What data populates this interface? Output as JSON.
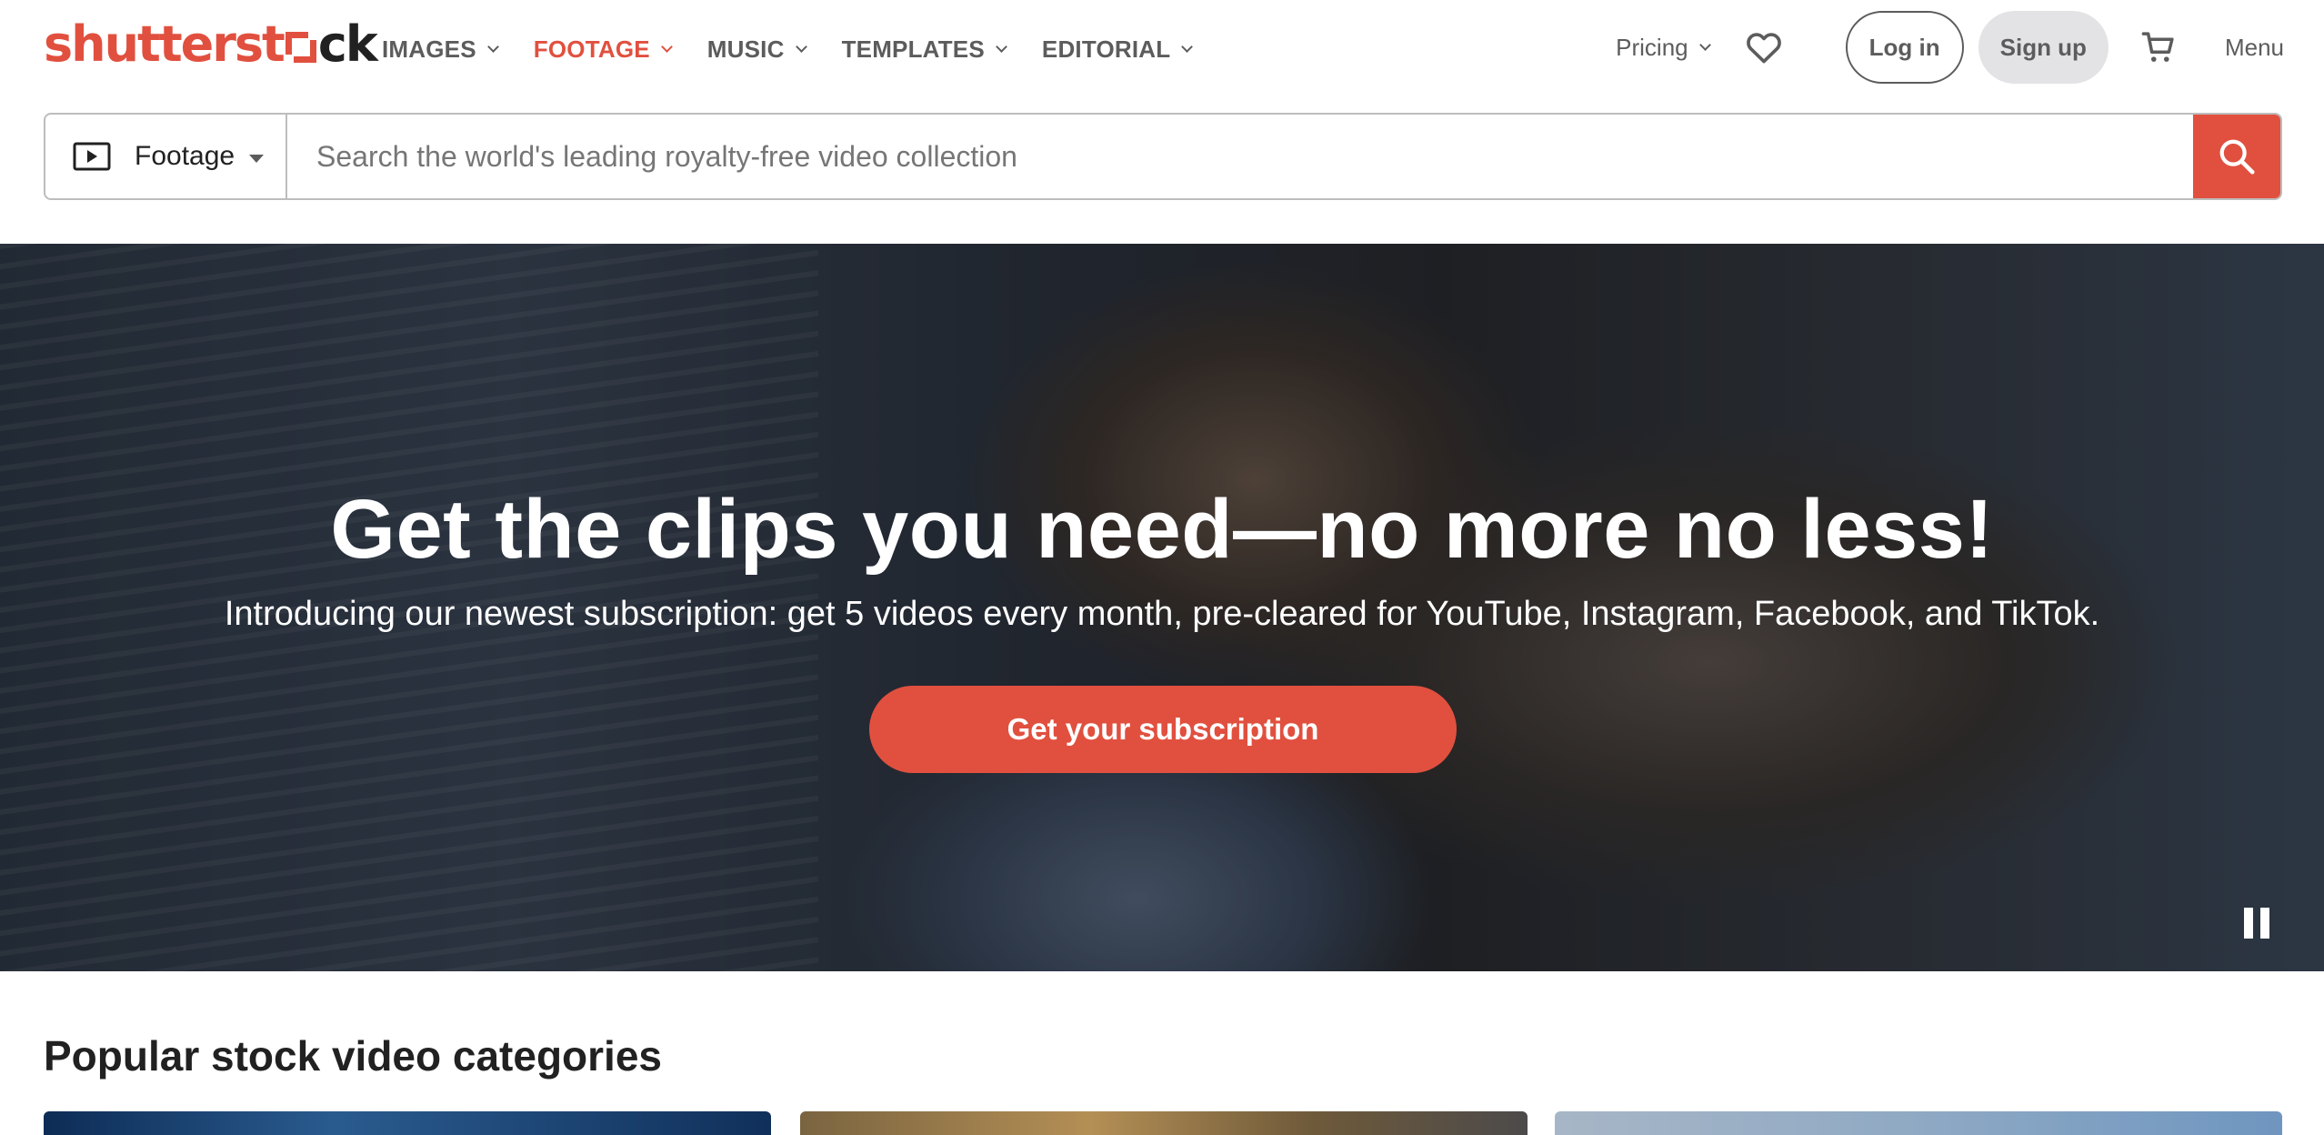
{
  "brand": {
    "logo_text_before": "shutterst",
    "logo_text_after": "ck",
    "colors": {
      "accent": "#e1503f",
      "text": "#212121",
      "muted": "#5c5c5c"
    }
  },
  "nav": {
    "items": [
      {
        "label": "IMAGES",
        "active": false
      },
      {
        "label": "FOOTAGE",
        "active": true
      },
      {
        "label": "MUSIC",
        "active": false
      },
      {
        "label": "TEMPLATES",
        "active": false
      },
      {
        "label": "EDITORIAL",
        "active": false
      }
    ],
    "pricing_label": "Pricing",
    "favorites_icon": "heart-icon",
    "login_label": "Log in",
    "signup_label": "Sign up",
    "cart_icon": "cart-icon",
    "menu_label": "Menu"
  },
  "search": {
    "media_type": "Footage",
    "media_icon": "play-video-icon",
    "placeholder": "Search the world's leading royalty-free video collection",
    "value": "",
    "button_icon": "search-icon"
  },
  "hero": {
    "title": "Get the clips you need—no more no less!",
    "subtitle": "Introducing our newest subscription: get 5 videos every month, pre-cleared for YouTube, Instagram, Facebook, and TikTok.",
    "cta_label": "Get your subscription",
    "pause_icon": "pause-icon"
  },
  "categories": {
    "title": "Popular stock video categories"
  }
}
